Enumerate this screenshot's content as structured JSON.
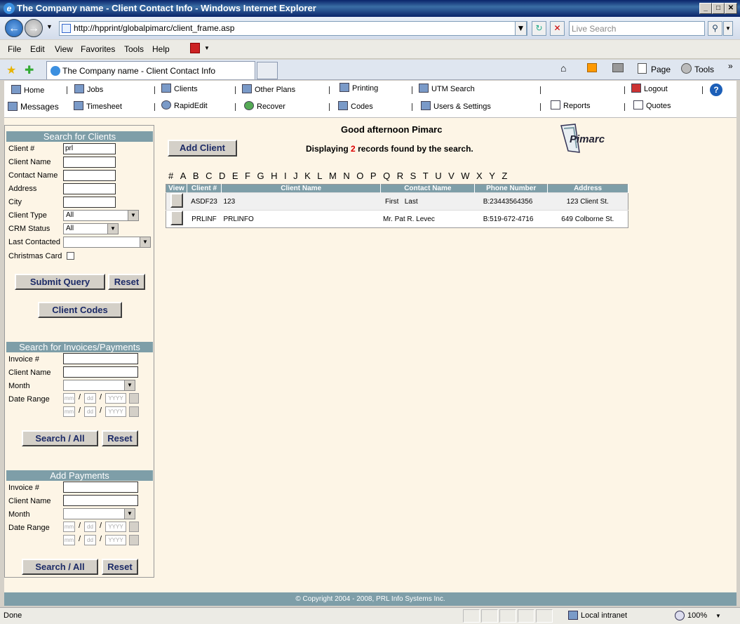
{
  "window": {
    "title": "The Company name - Client Contact Info - Windows Internet Explorer"
  },
  "browser": {
    "address": "http://hpprint/globalpimarc/client_frame.asp",
    "search_placeholder": "Live Search",
    "menu": [
      "File",
      "Edit",
      "View",
      "Favorites",
      "Tools",
      "Help"
    ],
    "tab_title": "The Company name - Client Contact Info",
    "tab_tools": [
      "Page",
      "Tools"
    ],
    "status_text": "Done",
    "zone": "Local intranet",
    "zoom": "100%"
  },
  "nav": {
    "row1": [
      "Home",
      "Jobs",
      "Clients",
      "Other Plans",
      "Printing",
      "UTM Search",
      "Logout"
    ],
    "row2": [
      "Messages",
      "Timesheet",
      "RapidEdit",
      "Recover",
      "Codes",
      "Users & Settings",
      "Reports",
      "Quotes"
    ]
  },
  "search_clients": {
    "heading": "Search for Clients",
    "labels": [
      "Client #",
      "Client Name",
      "Contact Name",
      "Address",
      "City",
      "Client Type",
      "CRM Status",
      "Last Contacted",
      "Christmas Card"
    ],
    "client_num_value": "prl",
    "client_type_value": "All",
    "crm_status_value": "All",
    "submit_label": "Submit Query",
    "reset_label": "Reset",
    "codes_label": "Client Codes"
  },
  "search_invoices": {
    "heading": "Search for Invoices/Payments",
    "labels": [
      "Invoice #",
      "Client Name",
      "Month",
      "Date Range"
    ],
    "date_mm": "mm",
    "date_dd": "dd",
    "date_yyyy": "YYYY",
    "search_label": "Search / All",
    "reset_label": "Reset"
  },
  "add_payments": {
    "heading": "Add Payments",
    "labels": [
      "Invoice #",
      "Client Name",
      "Month",
      "Date Range"
    ],
    "search_label": "Search / All",
    "reset_label": "Reset"
  },
  "main": {
    "greeting": "Good afternoon Pimarc",
    "display_prefix": "Displaying",
    "record_count": "2",
    "display_suffix": "records found by the search.",
    "add_client_label": "Add Client",
    "logo_text": "Pimarc",
    "alphabet": [
      "#",
      "A",
      "B",
      "C",
      "D",
      "E",
      "F",
      "G",
      "H",
      "I",
      "J",
      "K",
      "L",
      "M",
      "N",
      "O",
      "P",
      "Q",
      "R",
      "S",
      "T",
      "U",
      "V",
      "W",
      "X",
      "Y",
      "Z"
    ]
  },
  "results": {
    "columns": [
      "View",
      "Client #",
      "Client Name",
      "Contact Name",
      "Phone Number",
      "Address"
    ],
    "rows": [
      {
        "client_num": "ASDF23",
        "client_name": "123",
        "contact": "First   Last",
        "phone": "B:23443564356",
        "address": "123 Client St."
      },
      {
        "client_num": "PRLINF",
        "client_name": "PRLINFO",
        "contact": "Mr. Pat R. Levec",
        "phone": "B:519-672-4716",
        "address": "649 Colborne St."
      }
    ]
  },
  "footer": {
    "copyright": "© Copyright 2004 - 2008, PRL Info Systems Inc."
  }
}
